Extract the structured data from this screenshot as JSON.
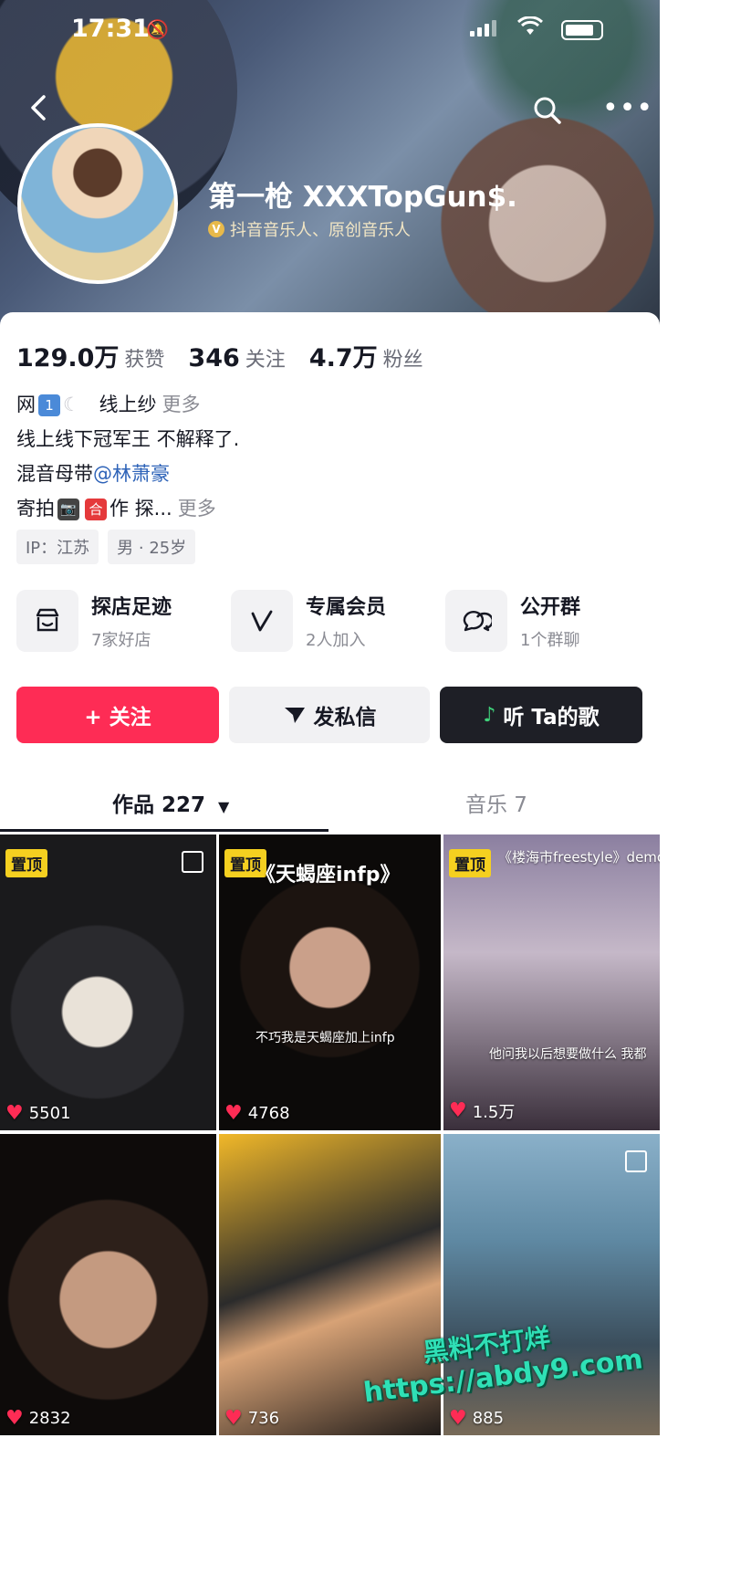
{
  "status_bar": {
    "time": "17:31"
  },
  "profile": {
    "name": "第一枪 XXXTopGun$.",
    "verified_text": "抖音音乐人、原创音乐人",
    "verified_badge": "V"
  },
  "stats": [
    {
      "value": "129.0万",
      "label": "获赞"
    },
    {
      "value": "346",
      "label": "关注"
    },
    {
      "value": "4.7万",
      "label": "粉丝"
    }
  ],
  "bio": {
    "line1_a": "网",
    "line1_box": "1",
    "line1_b": "线上纱",
    "line1_more": "更多",
    "line2": "线上线下冠军王 不解释了.",
    "line3_a": "混音母带",
    "line3_mention": "@林萧豪",
    "line4_a": "寄拍",
    "line4_box": "合",
    "line4_b": "作 探...",
    "line4_more": "更多"
  },
  "tags": [
    "IP：江苏",
    "男 · 25岁"
  ],
  "features": [
    {
      "title": "探店足迹",
      "sub": "7家好店",
      "icon": "store-icon"
    },
    {
      "title": "专属会员",
      "sub": "2人加入",
      "icon": "member-v-icon"
    },
    {
      "title": "公开群",
      "sub": "1个群聊",
      "icon": "group-chat-icon"
    }
  ],
  "buttons": {
    "follow": "+ 关注",
    "message": "发私信",
    "listen": "听 Ta的歌"
  },
  "tabs": {
    "works": "作品 227",
    "music": "音乐 7"
  },
  "videos": [
    {
      "pinned": "置顶",
      "likes": "5501",
      "title": ""
    },
    {
      "pinned": "置顶",
      "likes": "4768",
      "title": "《天蝎座infp》",
      "subtitle": "不巧我是天蝎座加上infp"
    },
    {
      "pinned": "置顶",
      "likes": "1.5万",
      "title": "《楼海市freestyle》demo",
      "subtitle": "他问我以后想要做什么 我都"
    },
    {
      "likes": "2832"
    },
    {
      "likes": "736"
    },
    {
      "likes": "885"
    }
  ],
  "watermark": {
    "line1": "黑料不打烊",
    "line2": "https://abdy9.com"
  },
  "colors": {
    "accent": "#fe2c55",
    "pin": "#f5d020",
    "mention": "#2e63b8",
    "dark_button": "#1e1f26"
  }
}
